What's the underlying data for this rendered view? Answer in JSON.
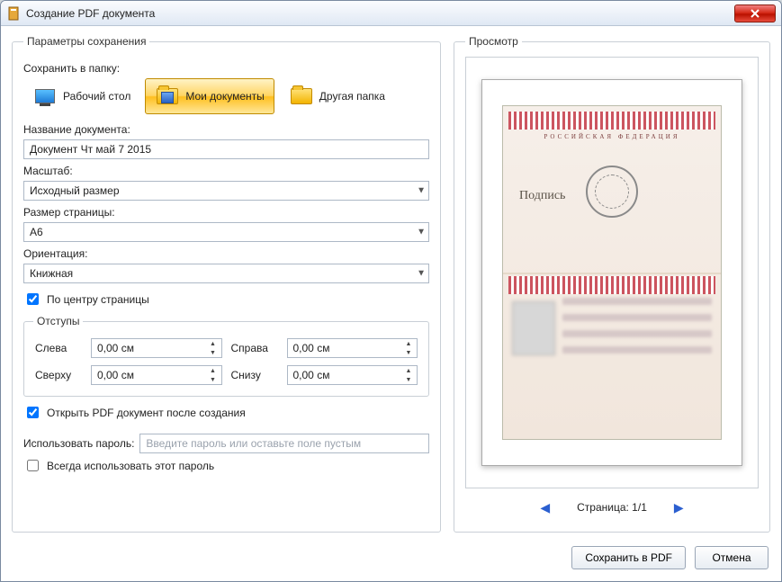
{
  "window": {
    "title": "Создание PDF документа"
  },
  "panels": {
    "params": "Параметры сохранения",
    "preview": "Просмотр",
    "margins": "Отступы"
  },
  "save_folder": {
    "label": "Сохранить в папку:",
    "desktop": "Рабочий стол",
    "my_documents": "Мои документы",
    "other": "Другая папка"
  },
  "doc_name": {
    "label": "Название документа:",
    "value": "Документ Чт май 7 2015"
  },
  "scale": {
    "label": "Масштаб:",
    "value": "Исходный размер"
  },
  "page_size": {
    "label": "Размер страницы:",
    "value": "A6"
  },
  "orientation": {
    "label": "Ориентация:",
    "value": "Книжная"
  },
  "center_page": {
    "label": "По центру страницы",
    "checked": true
  },
  "margins": {
    "left_label": "Слева",
    "left_value": "0,00 см",
    "right_label": "Справа",
    "right_value": "0,00 см",
    "top_label": "Сверху",
    "top_value": "0,00 см",
    "bottom_label": "Снизу",
    "bottom_value": "0,00 см"
  },
  "open_after": {
    "label": "Открыть PDF документ после создания",
    "checked": true
  },
  "password": {
    "label": "Использовать пароль:",
    "placeholder": "Введите пароль или оставьте поле пустым",
    "always_label": "Всегда использовать этот пароль",
    "always_checked": false
  },
  "preview": {
    "page_label": "Страница: 1/1",
    "doc_top_text": "РОССИЙСКАЯ ФЕДЕРАЦИЯ"
  },
  "footer": {
    "save": "Сохранить в PDF",
    "cancel": "Отмена"
  }
}
